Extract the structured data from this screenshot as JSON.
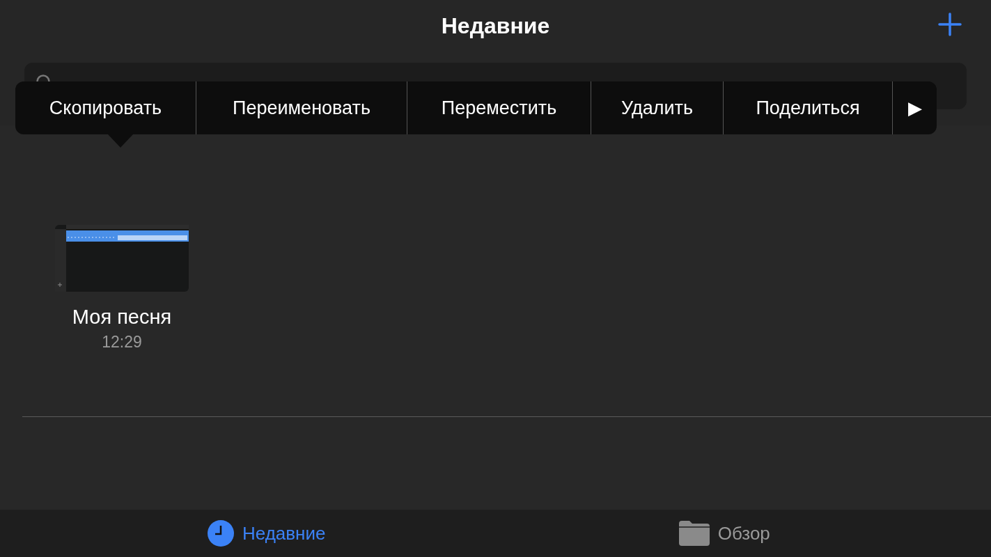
{
  "header": {
    "title": "Недавние"
  },
  "context_menu": {
    "items": [
      "Скопировать",
      "Переименовать",
      "Переместить",
      "Удалить",
      "Поделиться"
    ],
    "more": "▶"
  },
  "documents": [
    {
      "name": "Моя песня",
      "time": "12:29"
    }
  ],
  "tabs": [
    {
      "label": "Недавние",
      "selected": true,
      "kind": "recent"
    },
    {
      "label": "Обзор",
      "selected": false,
      "kind": "browse"
    }
  ]
}
